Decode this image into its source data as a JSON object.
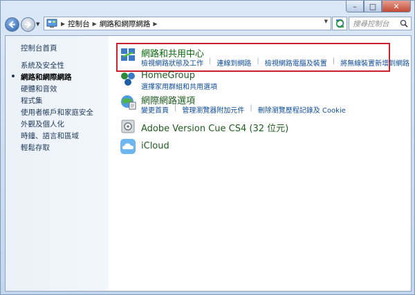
{
  "window": {
    "caption": {
      "minimize": "–",
      "maximize": "□",
      "close": "✕"
    }
  },
  "nav": {
    "breadcrumb": [
      "控制台",
      "網路和網際網路"
    ],
    "search_placeholder": "搜尋控制台"
  },
  "sidebar": {
    "items": [
      {
        "label": "控制台首頁",
        "active": false
      },
      {
        "label": "系統及安全性",
        "active": false
      },
      {
        "label": "網路和網際網路",
        "active": true
      },
      {
        "label": "硬體和音效",
        "active": false
      },
      {
        "label": "程式集",
        "active": false
      },
      {
        "label": "使用者帳戶和家庭安全",
        "active": false
      },
      {
        "label": "外觀及個人化",
        "active": false
      },
      {
        "label": "時鐘、語言和區域",
        "active": false
      },
      {
        "label": "輕鬆存取",
        "active": false
      }
    ]
  },
  "categories": [
    {
      "title": "網路和共用中心",
      "links": [
        "檢視網路狀態及工作",
        "連線到網路",
        "檢視網路電腦及裝置",
        "將無線裝置新增到網路"
      ]
    },
    {
      "title": "HomeGroup",
      "links": [
        "選擇家用群組和共用選項"
      ]
    },
    {
      "title": "網際網路選項",
      "links": [
        "變更首頁",
        "管理瀏覽器附加元件",
        "刪除瀏覽歷程記錄及 Cookie"
      ]
    },
    {
      "title": "Adobe Version Cue CS4 (32 位元)",
      "links": []
    },
    {
      "title": "iCloud",
      "links": []
    }
  ],
  "colors": {
    "highlight": "#c8232c",
    "link": "#0f4c97",
    "title": "#0b6a0b"
  }
}
